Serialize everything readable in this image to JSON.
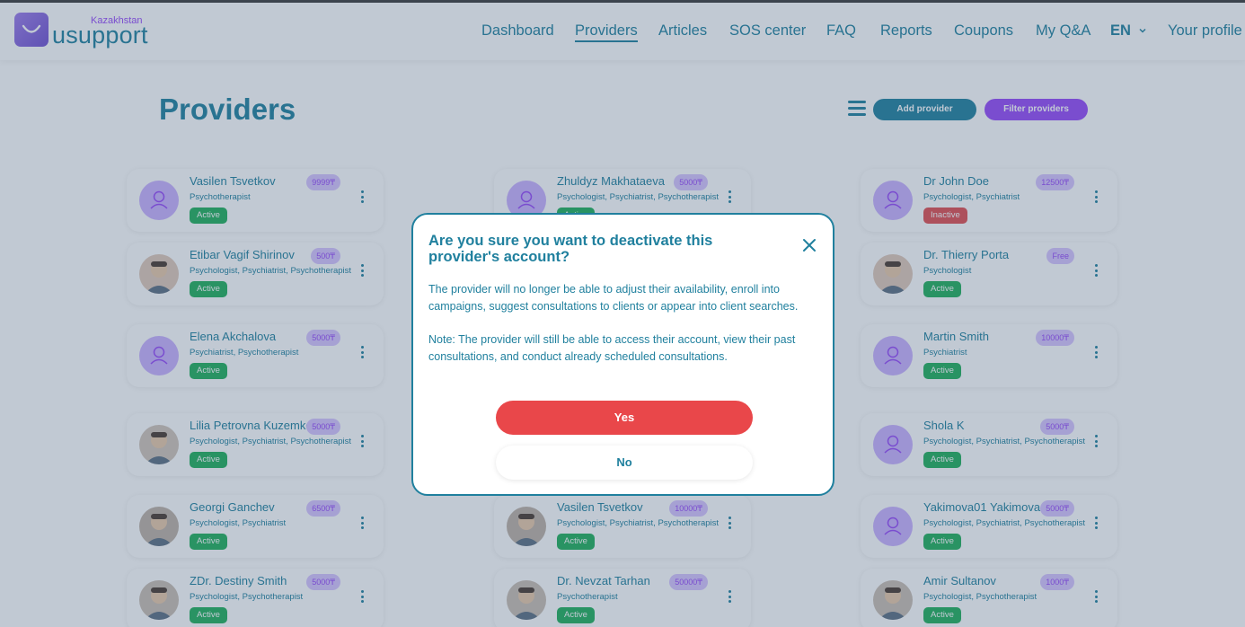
{
  "header": {
    "logo_country": "Kazakhstan",
    "logo_word": "usupport",
    "nav": [
      {
        "label": "Dashboard",
        "active": false
      },
      {
        "label": "Providers",
        "active": true
      },
      {
        "label": "Articles",
        "active": false
      },
      {
        "label": "SOS center",
        "active": false
      },
      {
        "label": "FAQ",
        "active": false
      },
      {
        "label": "Reports",
        "active": false
      },
      {
        "label": "Coupons",
        "active": false
      },
      {
        "label": "My Q&A",
        "active": false
      }
    ],
    "language": "EN",
    "profile": "Your profile"
  },
  "page": {
    "title": "Providers",
    "add_button": "Add provider",
    "filter_button": "Filter providers"
  },
  "providers": [
    {
      "name": "Vasilen Tsvetkov",
      "price": "9999₸",
      "specs": "Psychotherapist",
      "status": "Active"
    },
    {
      "name": "Zhuldyz Makhataeva",
      "price": "5000₸",
      "specs": "Psychologist, Psychiatrist, Psychotherapist",
      "status": "Active"
    },
    {
      "name": "Dr John Doe",
      "price": "12500₸",
      "specs": "Psychologist, Psychiatrist",
      "status": "Inactive"
    },
    {
      "name": "Etibar Vagif Shirinov",
      "price": "500₸",
      "specs": "Psychologist, Psychiatrist, Psychotherapist",
      "status": "Active"
    },
    {
      "name": "",
      "price": "",
      "specs": "",
      "status": ""
    },
    {
      "name": "Dr. Thierry Porta",
      "price": "Free",
      "specs": "Psychologist",
      "status": "Active"
    },
    {
      "name": "Elena Akchalova",
      "price": "5000₸",
      "specs": "Psychiatrist, Psychotherapist",
      "status": "Active"
    },
    {
      "name": "",
      "price": "",
      "specs": "",
      "status": ""
    },
    {
      "name": "Martin Smith",
      "price": "10000₸",
      "specs": "Psychiatrist",
      "status": "Active"
    },
    {
      "name": "Lilia Petrovna Kuzemko",
      "price": "5000₸",
      "specs": "Psychologist, Psychiatrist, Psychotherapist",
      "status": "Active"
    },
    {
      "name": "",
      "price": "",
      "specs": "",
      "status": ""
    },
    {
      "name": "Shola K",
      "price": "5000₸",
      "specs": "Psychologist, Psychiatrist, Psychotherapist",
      "status": "Active"
    },
    {
      "name": "Georgi Ganchev",
      "price": "6500₸",
      "specs": "Psychologist, Psychiatrist",
      "status": "Active"
    },
    {
      "name": "Vasilen Tsvetkov",
      "price": "10000₸",
      "specs": "Psychologist, Psychiatrist, Psychotherapist",
      "status": "Active"
    },
    {
      "name": "Yakimova01 Yakimova",
      "price": "5000₸",
      "specs": "Psychologist, Psychiatrist, Psychotherapist",
      "status": "Active"
    },
    {
      "name": "ZDr. Destiny Smith",
      "price": "5000₸",
      "specs": "Psychologist, Psychotherapist",
      "status": "Active"
    },
    {
      "name": "Dr. Nevzat Tarhan",
      "price": "50000₸",
      "specs": "Psychotherapist",
      "status": "Active"
    },
    {
      "name": "Amir Sultanov",
      "price": "1000₸",
      "specs": "Psychologist, Psychotherapist",
      "status": "Active"
    }
  ],
  "modal": {
    "title": "Are you sure you want to deactivate this provider's account?",
    "text1": "The provider will no longer be able to adjust their availability, enroll into campaigns, suggest consultations to clients or appear into client searches.",
    "text2": "Note: The provider will still be able to access their account, view their past consultations, and conduct already scheduled consultations.",
    "yes": "Yes",
    "no": "No"
  },
  "colors": {
    "primary": "#20809e",
    "secondary": "#9749fa",
    "danger": "#e9474a",
    "success": "#20b05a"
  }
}
